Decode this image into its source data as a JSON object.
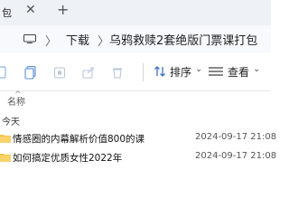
{
  "window": {
    "tab_title": "包",
    "close_glyph": "✕",
    "new_tab_glyph": "+"
  },
  "addressbar": {
    "separator": "〉",
    "breadcrumb": [
      "下载",
      "乌鸦救赎2套绝版门票课打包"
    ]
  },
  "toolbar": {
    "sort_label": "排序",
    "view_label": "查看",
    "caret": "⌄"
  },
  "list": {
    "column_name": "名称",
    "group_label": "今天",
    "items": [
      {
        "name": "情感圈的内幕解析价值800的课",
        "date": "2024-09-17 21:08"
      },
      {
        "name": "如何搞定优质女性2022年",
        "date": "2024-09-17 21:08"
      }
    ]
  },
  "colors": {
    "folder": "#f4c542",
    "titlebar": "#eef1f6",
    "accent": "#2b6fd6"
  }
}
